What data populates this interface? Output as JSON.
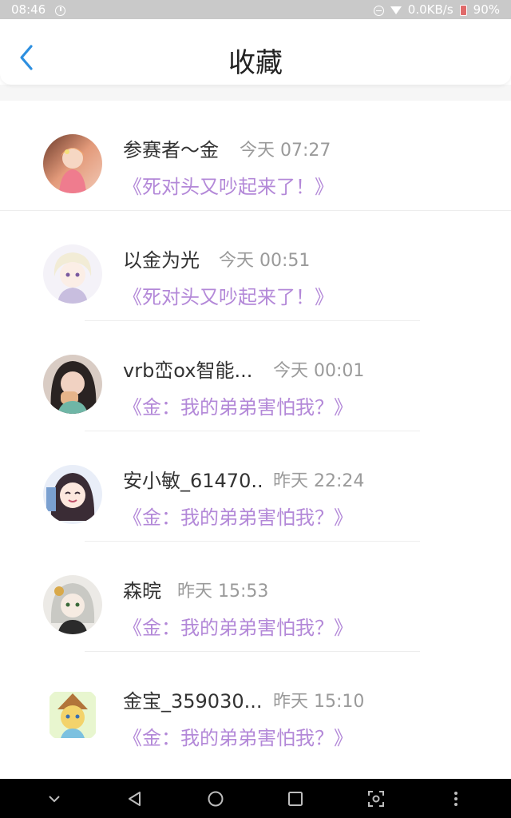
{
  "status_bar": {
    "time": "08:46",
    "speed": "0.0KB/s",
    "battery": "90%"
  },
  "header": {
    "title": "收藏",
    "back_icon": "chevron-left-icon",
    "accent_color": "#2d8fe0"
  },
  "items": [
    {
      "username": "参赛者〜金",
      "time": "今天 07:27",
      "story": "《死对头又吵起来了！》"
    },
    {
      "username": "以金为光",
      "time": "今天 00:51",
      "story": "《死对头又吵起来了！》"
    },
    {
      "username": "vrb峦ox智能...",
      "time": "今天 00:01",
      "story": "《金：我的弟弟害怕我？》"
    },
    {
      "username": "安小敏_61470..",
      "time": "昨天 22:24",
      "story": "《金：我的弟弟害怕我？》"
    },
    {
      "username": "森晥",
      "time": "昨天 15:53",
      "story": "《金：我的弟弟害怕我？》"
    },
    {
      "username": "金宝_359030...",
      "time": "昨天 15:10",
      "story": "《金：我的弟弟害怕我？》"
    }
  ],
  "colors": {
    "story_link": "#b388d8",
    "timestamp": "#9a9a9a",
    "username": "#333333"
  },
  "nav": {
    "buttons": [
      "chevron-down-icon",
      "back-triangle-icon",
      "home-circle-icon",
      "recents-square-icon",
      "screenshot-icon",
      "more-dots-icon"
    ]
  }
}
